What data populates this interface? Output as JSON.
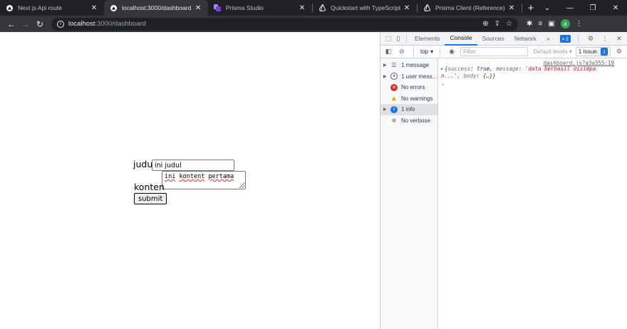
{
  "tabs": [
    {
      "title": "Next js Api route",
      "icon": "vercel-triangle-icon"
    },
    {
      "title": "localhost:3000/dashboard",
      "icon": "vercel-triangle-icon",
      "active": true
    },
    {
      "title": "Prisma Studio",
      "icon": "prisma-studio-icon"
    },
    {
      "title": "Quickstart with TypeScript &",
      "icon": "prisma-icon"
    },
    {
      "title": "Prisma Client (Reference)",
      "icon": "prisma-icon"
    }
  ],
  "window_controls": {
    "minimize": "—",
    "restore": "❐",
    "close": "✕"
  },
  "address": {
    "host": "localhost",
    "path": ":3000/dashboard"
  },
  "profile_initial": "a",
  "form": {
    "judul_label": "judul",
    "judul_value": "ini judul",
    "konten_label": "konten",
    "konten_value_words": [
      "ini",
      "kontent",
      "pertama"
    ],
    "submit_label": "submit"
  },
  "devtools": {
    "tabs": [
      "Elements",
      "Console",
      "Sources",
      "Network"
    ],
    "active_tab": "Console",
    "more": "»",
    "badge_count": "1",
    "context": "top",
    "filter_placeholder": "Filter",
    "levels": "Default levels",
    "issue_label": "1 Issue:",
    "issue_count": "1",
    "sidebar": [
      {
        "label": "1 message",
        "icon": "list-icon",
        "arrow": true
      },
      {
        "label": "1 user mess...",
        "icon": "user-icon",
        "arrow": true
      },
      {
        "label": "No errors",
        "icon": "error-icon",
        "arrow": false
      },
      {
        "label": "No warnings",
        "icon": "warning-icon",
        "arrow": false
      },
      {
        "label": "1 info",
        "icon": "info-icon",
        "arrow": true,
        "selected": true
      },
      {
        "label": "No verbose",
        "icon": "bug-icon",
        "arrow": false
      }
    ],
    "source_link": "dashboard.js?a3a355:19",
    "log": {
      "open": "{",
      "k1": "success",
      "v1": "true",
      "k2": "message",
      "v2a": "'data berhasil disimpa",
      "v2b": "n...'",
      "k3": "body",
      "v3": "{…}",
      "close": "}"
    },
    "prompt": "›"
  },
  "colors": {
    "accent": "#1a73e8",
    "chrome_dark": "#202124",
    "toolbar": "#35363a"
  }
}
